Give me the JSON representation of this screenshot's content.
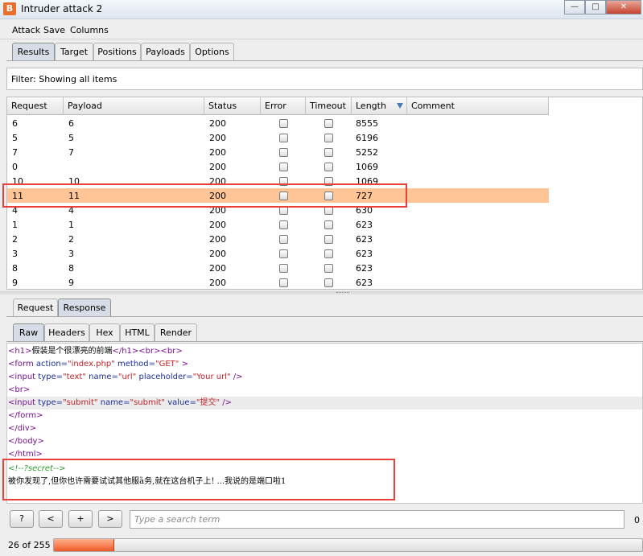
{
  "window": {
    "title": "Intruder attack 2",
    "icon_letter": "B"
  },
  "menu": [
    "Attack",
    "Save",
    "Columns"
  ],
  "top_tabs": [
    {
      "label": "Results",
      "active": true
    },
    {
      "label": "Target",
      "active": false
    },
    {
      "label": "Positions",
      "active": false
    },
    {
      "label": "Payloads",
      "active": false
    },
    {
      "label": "Options",
      "active": false
    }
  ],
  "filter": {
    "text": "Filter:  Showing all items"
  },
  "table": {
    "columns": [
      "Request",
      "Payload",
      "Status",
      "Error",
      "Timeout",
      "Length",
      "Comment"
    ],
    "sorted_column": "Length",
    "rows": [
      {
        "request": "6",
        "payload": "6",
        "status": "200",
        "error": false,
        "timeout": false,
        "length": "8555",
        "selected": false
      },
      {
        "request": "5",
        "payload": "5",
        "status": "200",
        "error": false,
        "timeout": false,
        "length": "6196",
        "selected": false
      },
      {
        "request": "7",
        "payload": "7",
        "status": "200",
        "error": false,
        "timeout": false,
        "length": "5252",
        "selected": false
      },
      {
        "request": "0",
        "payload": "",
        "status": "200",
        "error": false,
        "timeout": false,
        "length": "1069",
        "selected": false
      },
      {
        "request": "10",
        "payload": "10",
        "status": "200",
        "error": false,
        "timeout": false,
        "length": "1069",
        "selected": false
      },
      {
        "request": "11",
        "payload": "11",
        "status": "200",
        "error": false,
        "timeout": false,
        "length": "727",
        "selected": true
      },
      {
        "request": "4",
        "payload": "4",
        "status": "200",
        "error": false,
        "timeout": false,
        "length": "630",
        "selected": false
      },
      {
        "request": "1",
        "payload": "1",
        "status": "200",
        "error": false,
        "timeout": false,
        "length": "623",
        "selected": false
      },
      {
        "request": "2",
        "payload": "2",
        "status": "200",
        "error": false,
        "timeout": false,
        "length": "623",
        "selected": false
      },
      {
        "request": "3",
        "payload": "3",
        "status": "200",
        "error": false,
        "timeout": false,
        "length": "623",
        "selected": false
      },
      {
        "request": "8",
        "payload": "8",
        "status": "200",
        "error": false,
        "timeout": false,
        "length": "623",
        "selected": false
      },
      {
        "request": "9",
        "payload": "9",
        "status": "200",
        "error": false,
        "timeout": false,
        "length": "623",
        "selected": false
      }
    ]
  },
  "msg_tabs": [
    {
      "label": "Request",
      "active": false
    },
    {
      "label": "Response",
      "active": true
    }
  ],
  "view_tabs": [
    {
      "label": "Raw",
      "active": true
    },
    {
      "label": "Headers",
      "active": false
    },
    {
      "label": "Hex",
      "active": false
    },
    {
      "label": "HTML",
      "active": false
    },
    {
      "label": "Render",
      "active": false
    }
  ],
  "response_lines": [
    [
      [
        "tg",
        "<h1>"
      ],
      [
        "cjk",
        "假装是个很漂亮的前端"
      ],
      [
        "tg",
        "</h1>"
      ],
      [
        "tg",
        "<br>"
      ],
      [
        "tg",
        "<br>"
      ]
    ],
    [
      [
        "tg",
        "<form "
      ],
      [
        "at",
        "action="
      ],
      [
        "vl",
        "\"index.php\""
      ],
      [
        "at",
        " method="
      ],
      [
        "vl",
        "\"GET\""
      ],
      [
        "tg",
        " >"
      ]
    ],
    [
      [
        "tg",
        "<input "
      ],
      [
        "at",
        "type="
      ],
      [
        "vl",
        "\"text\""
      ],
      [
        "at",
        " name="
      ],
      [
        "vl",
        "\"url\""
      ],
      [
        "at",
        " placeholder="
      ],
      [
        "vl",
        "\"Your url\""
      ],
      [
        "tg",
        " />"
      ]
    ],
    [
      [
        "tg",
        "<br>"
      ]
    ],
    [
      [
        "tg",
        "<input "
      ],
      [
        "at",
        "type="
      ],
      [
        "vl",
        "\"submit\""
      ],
      [
        "at",
        " name="
      ],
      [
        "vl",
        "\"submit\""
      ],
      [
        "at",
        " value="
      ],
      [
        "vl",
        "\"提交\""
      ],
      [
        "tg",
        " />"
      ]
    ],
    [
      [
        "tg",
        "</form>"
      ]
    ],
    [
      [
        "tg",
        "</div>"
      ]
    ],
    [
      [
        "tg",
        "</body>"
      ]
    ],
    [
      [
        "tg",
        "</html>"
      ]
    ],
    [
      [
        "cm",
        "<!--?secret-->"
      ]
    ],
    [
      [
        "cjk",
        "被你发现了,但你也许需要试试其他服ȁ务,就在这台机子上! ...我说的是端口啦1"
      ]
    ]
  ],
  "highlighted_line_index": 4,
  "search": {
    "placeholder": "Type a search term",
    "match_count": "0",
    "buttons": [
      "?",
      "<",
      "+",
      ">"
    ]
  },
  "status": {
    "text": "26 of 255",
    "progress_fraction": 0.102
  },
  "colors": {
    "selected_row": "#ffc596",
    "annotation_box": "#e8403a",
    "progress": "#f05a28"
  }
}
